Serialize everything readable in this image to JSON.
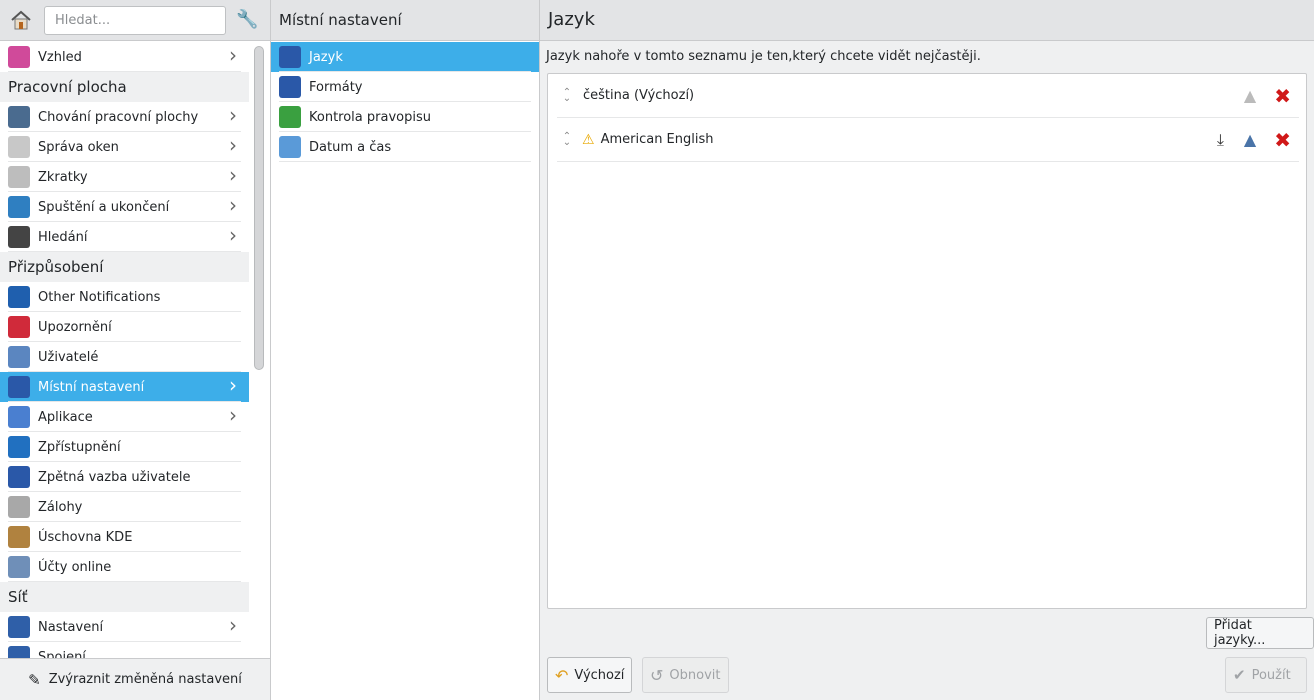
{
  "sidebar": {
    "search_placeholder": "Hledat...",
    "items": [
      {
        "type": "item",
        "label": "Vzhled",
        "icon": "appearance-icon",
        "color": "#d04a9a",
        "chev": true
      },
      {
        "type": "section",
        "label": "Pracovní plocha"
      },
      {
        "type": "item",
        "label": "Chování pracovní plochy",
        "icon": "desktop-behavior-icon",
        "color": "#4a6b8f",
        "chev": true
      },
      {
        "type": "item",
        "label": "Správa oken",
        "icon": "window-management-icon",
        "color": "#c8c8c8",
        "chev": true
      },
      {
        "type": "item",
        "label": "Zkratky",
        "icon": "keyboard-icon",
        "color": "#bdbdbd",
        "chev": true
      },
      {
        "type": "item",
        "label": "Spuštění a ukončení",
        "icon": "startup-shutdown-icon",
        "color": "#2f7fc1",
        "chev": true
      },
      {
        "type": "item",
        "label": "Hledání",
        "icon": "binoculars-icon",
        "color": "#444",
        "chev": true
      },
      {
        "type": "section",
        "label": "Přizpůsobení"
      },
      {
        "type": "item",
        "label": "Other Notifications",
        "icon": "info-icon",
        "color": "#1f5fae",
        "chev": false
      },
      {
        "type": "item",
        "label": "Upozornění",
        "icon": "bell-icon",
        "color": "#d02a3a",
        "chev": false
      },
      {
        "type": "item",
        "label": "Uživatelé",
        "icon": "user-icon",
        "color": "#5b86c0",
        "chev": false
      },
      {
        "type": "item",
        "label": "Místní nastavení",
        "icon": "un-flag-icon",
        "color": "#2a58a8",
        "chev": true,
        "selected": true
      },
      {
        "type": "item",
        "label": "Aplikace",
        "icon": "applications-icon",
        "color": "#4a7fd0",
        "chev": true
      },
      {
        "type": "item",
        "label": "Zpřístupnění",
        "icon": "accessibility-icon",
        "color": "#2170c0",
        "chev": false
      },
      {
        "type": "item",
        "label": "Zpětná vazba uživatele",
        "icon": "feedback-icon",
        "color": "#2a58a8",
        "chev": false
      },
      {
        "type": "item",
        "label": "Zálohy",
        "icon": "backup-icon",
        "color": "#a8a8a8",
        "chev": false
      },
      {
        "type": "item",
        "label": "Úschovna KDE",
        "icon": "wallet-icon",
        "color": "#b0823f",
        "chev": false
      },
      {
        "type": "item",
        "label": "Účty online",
        "icon": "online-accounts-icon",
        "color": "#6f8fb8",
        "chev": false
      },
      {
        "type": "section",
        "label": "Síť"
      },
      {
        "type": "item",
        "label": "Nastavení",
        "icon": "network-settings-icon",
        "color": "#2f5fa8",
        "chev": true
      },
      {
        "type": "item",
        "label": "Spojení",
        "icon": "connections-icon",
        "color": "#2f5fa8",
        "chev": false
      }
    ],
    "footer_label": "Zvýraznit změněná nastavení"
  },
  "middle": {
    "title": "Místní nastavení",
    "items": [
      {
        "label": "Jazyk",
        "icon": "un-flag-icon",
        "color": "#2a58a8",
        "selected": true
      },
      {
        "label": "Formáty",
        "icon": "un-flag-icon",
        "color": "#2a58a8"
      },
      {
        "label": "Kontrola pravopisu",
        "icon": "spellcheck-icon",
        "color": "#3aa040"
      },
      {
        "label": "Datum a čas",
        "icon": "clock-icon",
        "color": "#5a9ad8"
      }
    ]
  },
  "main": {
    "title": "Jazyk",
    "description": "Jazyk nahoře v tomto seznamu je ten,který chcete vidět nejčastěji.",
    "languages": [
      {
        "label": "čeština (Výchozí)",
        "warning": false,
        "promote_enabled": false,
        "download": false
      },
      {
        "label": "American English",
        "warning": true,
        "promote_enabled": true,
        "download": true
      }
    ],
    "add_button": "Přidat jazyky...",
    "defaults_button": "Výchozí",
    "reset_button": "Obnovit",
    "apply_button": "Použít"
  }
}
